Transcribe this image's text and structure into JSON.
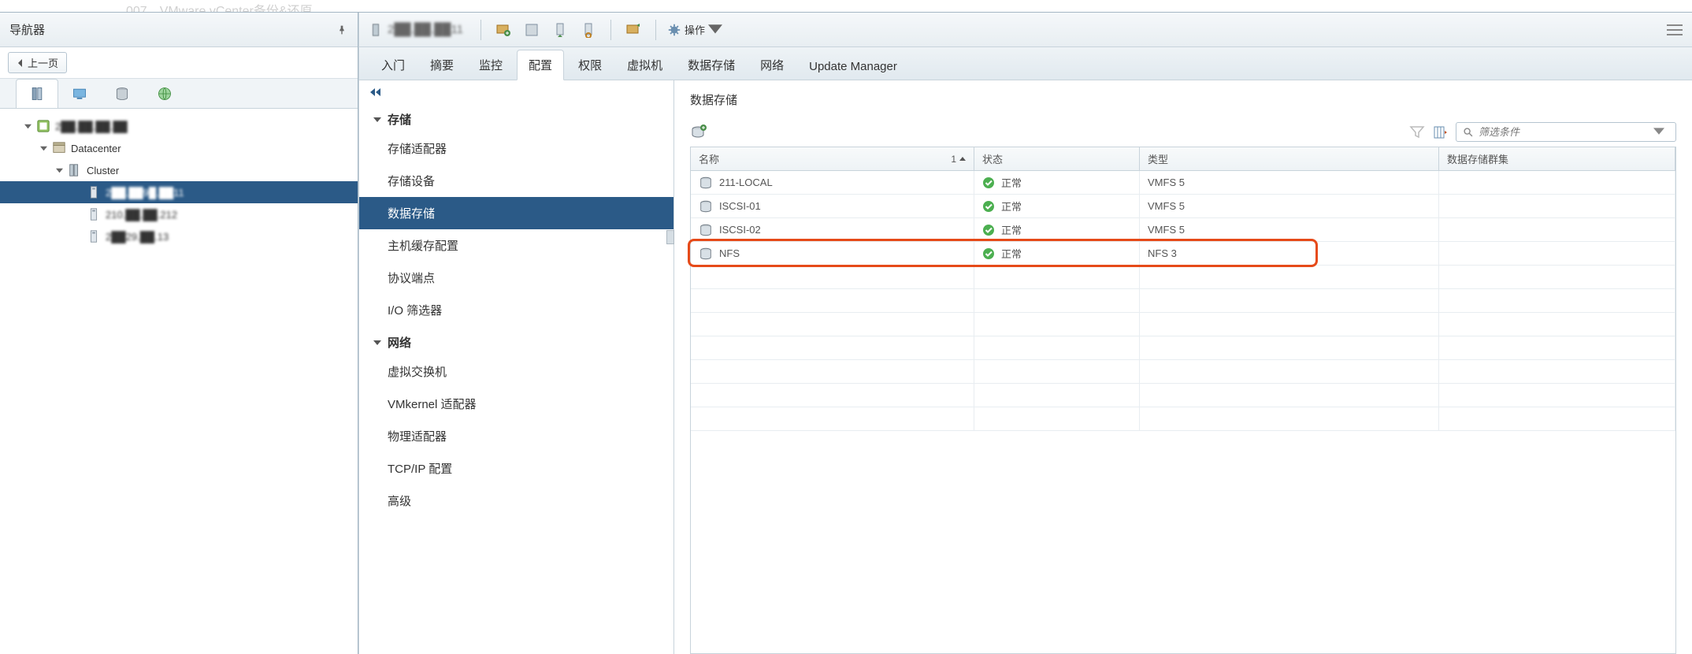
{
  "navigator": {
    "title": "导航器",
    "back_label": "上一页",
    "tree": {
      "vcenter": "2██.██.██.██",
      "datacenter": "Datacenter",
      "cluster": "Cluster",
      "hosts": [
        "2██.██9█.██11",
        "210.██.██.212",
        "2██29.██.13"
      ]
    }
  },
  "toolbar": {
    "host_label": "2██.██.██11",
    "actions_label": "操作"
  },
  "tabs": [
    "入门",
    "摘要",
    "监控",
    "配置",
    "权限",
    "虚拟机",
    "数据存储",
    "网络",
    "Update Manager"
  ],
  "active_tab_index": 3,
  "config_side": {
    "groups": [
      {
        "title": "存储",
        "items": [
          "存储适配器",
          "存储设备",
          "数据存储",
          "主机缓存配置",
          "协议端点",
          "I/O 筛选器"
        ],
        "selected_index": 2
      },
      {
        "title": "网络",
        "items": [
          "虚拟交换机",
          "VMkernel 适配器",
          "物理适配器",
          "TCP/IP 配置",
          "高级"
        ]
      }
    ]
  },
  "datastore": {
    "title": "数据存储",
    "filter_placeholder": "筛选条件",
    "columns": {
      "name": "名称",
      "status": "状态",
      "type": "类型",
      "cluster": "数据存储群集",
      "sort_indicator": "1"
    },
    "rows": [
      {
        "name": "211-LOCAL",
        "status": "正常",
        "type": "VMFS 5"
      },
      {
        "name": "ISCSI-01",
        "status": "正常",
        "type": "VMFS 5"
      },
      {
        "name": "ISCSI-02",
        "status": "正常",
        "type": "VMFS 5"
      },
      {
        "name": "NFS",
        "status": "正常",
        "type": "NFS 3"
      }
    ],
    "highlight_row_index": 3
  }
}
